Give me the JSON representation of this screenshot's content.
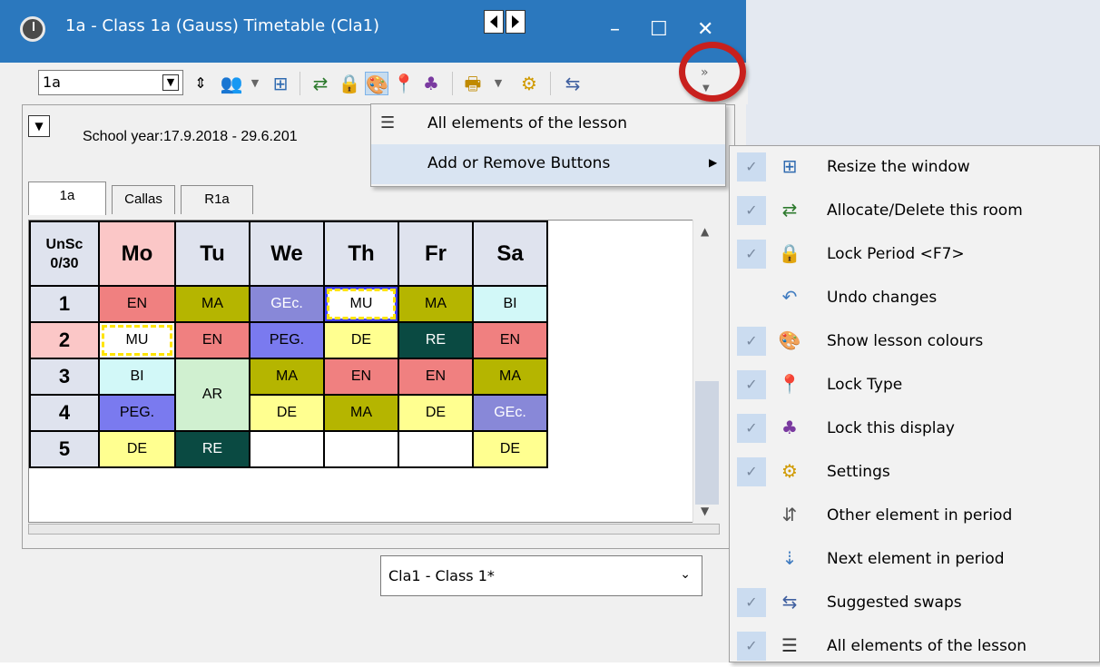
{
  "window": {
    "title": "1a - Class 1a (Gauss)  Timetable  (Cla1)",
    "minimize": "–",
    "maximize": "☐",
    "close": "✕"
  },
  "toolbar": {
    "class_value": "1a",
    "overflow_glyph": "»"
  },
  "header_info": {
    "school_year": "School year:17.9.2018 - 29.6.201"
  },
  "tabs": [
    {
      "label": "1a"
    },
    {
      "label": "Callas"
    },
    {
      "label": "R1a"
    }
  ],
  "timetable": {
    "corner_line1": "UnSc",
    "corner_line2": "0/30",
    "days": [
      "Mo",
      "Tu",
      "We",
      "Th",
      "Fr",
      "Sa"
    ],
    "periods": [
      "1",
      "2",
      "3",
      "4",
      "5"
    ],
    "cells": {
      "p1": [
        "EN",
        "MA",
        "GEc.",
        "MU",
        "MA",
        "BI"
      ],
      "p2": [
        "MU",
        "EN",
        "PEG.",
        "DE",
        "RE",
        "EN"
      ],
      "p3": [
        "BI",
        "AR",
        "MA",
        "EN",
        "EN",
        "MA"
      ],
      "p4": [
        "PEG.",
        "DE",
        "MA",
        "DE",
        "GEc."
      ],
      "p5": [
        "DE",
        "RE",
        "",
        "",
        "",
        "DE"
      ]
    },
    "colors": {
      "EN": "#f08080",
      "MA": "#b5b500",
      "GEc": "#8888d8",
      "MU": "#ffffff",
      "BI": "#d2f8f8",
      "PEG": "#7a7aef",
      "DE": "#ffff90",
      "RE": "#0a4a42",
      "AR": "#d0f0d0",
      "header_mo": "#fbc7c7",
      "header": "#dfe3ee"
    }
  },
  "bottom_combo": {
    "value": "Cla1 - Class 1*"
  },
  "menu_overflow": {
    "items": [
      {
        "label": "All elements of the lesson",
        "icon": "list-filter-icon"
      },
      {
        "label": "Add or Remove Buttons",
        "icon": "",
        "submenu_arrow": "▶"
      }
    ]
  },
  "menu_buttons": {
    "items": [
      {
        "label": "Resize the window",
        "checked": true,
        "icon": "resize-window-icon",
        "glyph": "⊞"
      },
      {
        "label": "Allocate/Delete this room",
        "checked": true,
        "icon": "allocate-room-icon",
        "glyph": "⇄"
      },
      {
        "label": "Lock Period <F7>",
        "checked": true,
        "icon": "padlock-icon",
        "glyph": "🔒"
      },
      {
        "label": "Undo changes",
        "checked": false,
        "icon": "undo-icon",
        "glyph": "↶"
      },
      {
        "label": "Show lesson colours",
        "checked": true,
        "icon": "palette-icon",
        "glyph": "🎨"
      },
      {
        "label": "Lock Type",
        "checked": true,
        "icon": "pushpin-icon",
        "glyph": "📍"
      },
      {
        "label": "Lock this display",
        "checked": true,
        "icon": "lock-display-icon",
        "glyph": "♣"
      },
      {
        "label": "Settings",
        "checked": true,
        "icon": "gear-icon",
        "glyph": "⚙"
      },
      {
        "label": "Other element in period",
        "checked": false,
        "icon": "other-element-icon",
        "glyph": "⇵"
      },
      {
        "label": "Next element in period",
        "checked": false,
        "icon": "next-element-icon",
        "glyph": "⇣"
      },
      {
        "label": "Suggested swaps",
        "checked": true,
        "icon": "swap-icon",
        "glyph": "⇆"
      },
      {
        "label": "All elements of the lesson",
        "checked": true,
        "icon": "list-filter-icon",
        "glyph": "☰"
      }
    ]
  }
}
